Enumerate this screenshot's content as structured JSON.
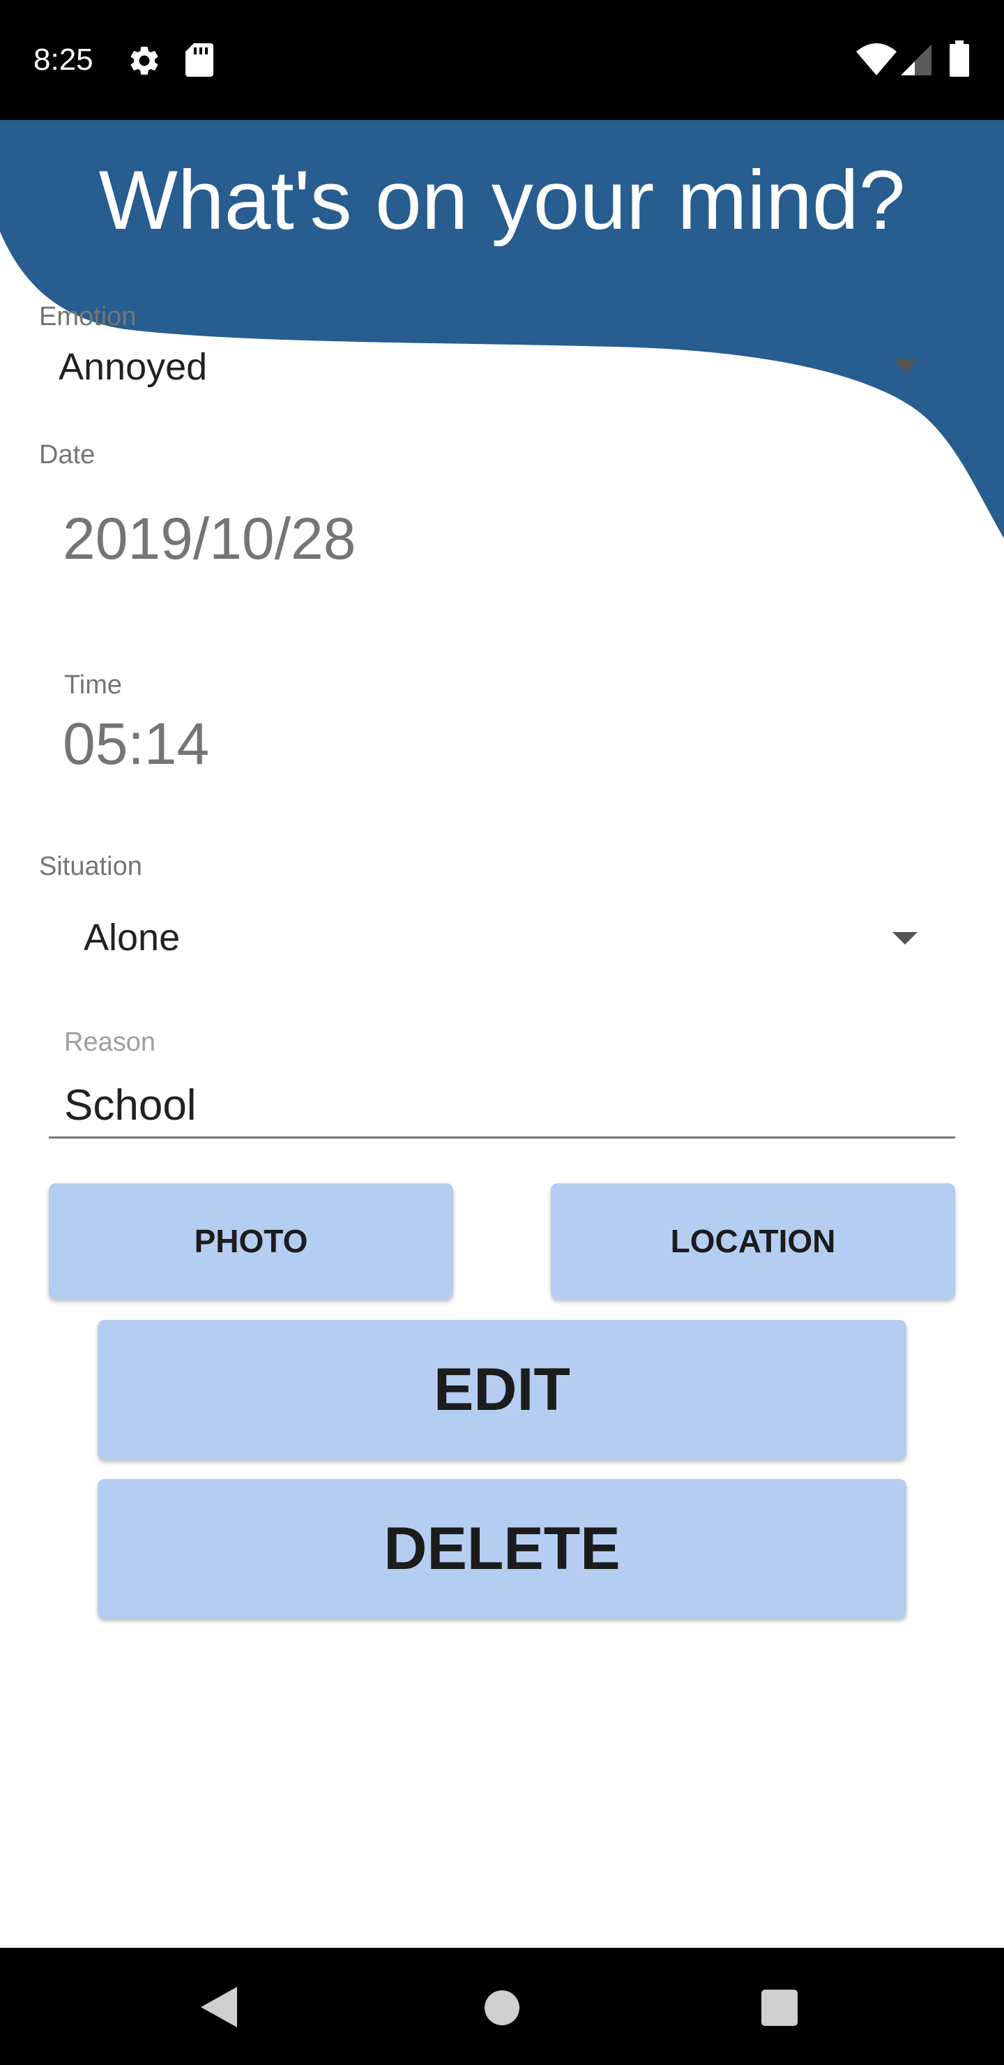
{
  "status_bar": {
    "time": "8:25",
    "left_icons": [
      "settings-icon",
      "sd-card-icon"
    ],
    "right_icons": [
      "wifi-icon",
      "cell-signal-icon",
      "battery-icon"
    ]
  },
  "header": {
    "title": "What's on your mind?",
    "color": "#275d8f"
  },
  "form": {
    "emotion": {
      "label": "Emotion",
      "value": "Annoyed"
    },
    "date": {
      "label": "Date",
      "value": "2019/10/28"
    },
    "time": {
      "label": "Time",
      "value": "05:14"
    },
    "situation": {
      "label": "Situation",
      "value": "Alone"
    },
    "reason": {
      "label": "Reason",
      "value": "School"
    }
  },
  "buttons": {
    "photo": "PHOTO",
    "location": "LOCATION",
    "edit": "EDIT",
    "delete": "DELETE",
    "color": "#b6cdf2"
  },
  "nav_bar": {
    "icons": [
      "back-icon",
      "home-icon",
      "recents-icon"
    ]
  }
}
